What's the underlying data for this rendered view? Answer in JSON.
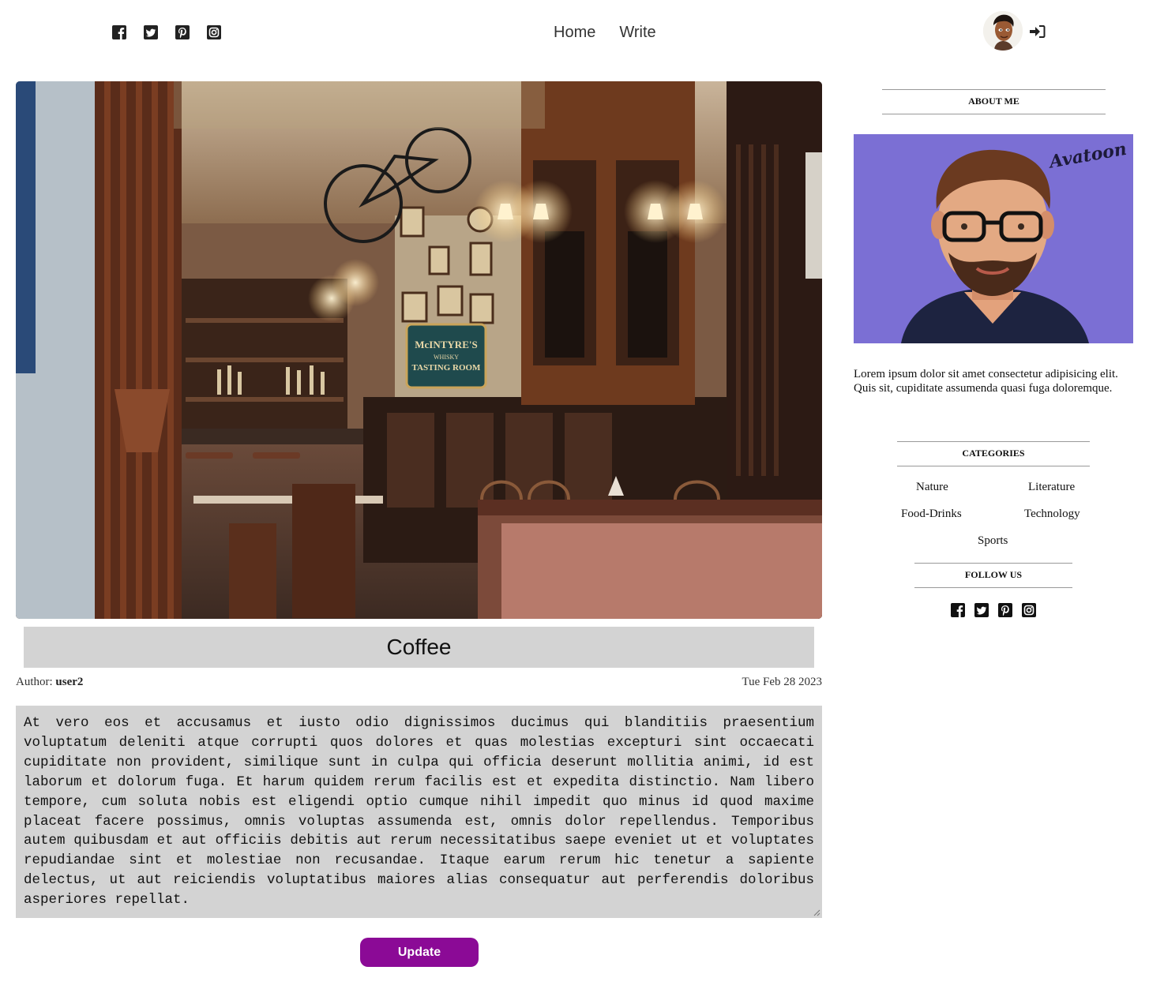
{
  "header": {
    "social_icons": [
      "facebook-icon",
      "twitter-icon",
      "pinterest-icon",
      "instagram-icon"
    ],
    "nav": [
      {
        "label": "Home"
      },
      {
        "label": "Write"
      }
    ],
    "user_icon": "avatar",
    "login_icon": "sign-in-icon"
  },
  "post": {
    "title": "Coffee",
    "author_prefix": "Author:",
    "author": "user2",
    "date": "Tue Feb 28 2023",
    "body": "At vero eos et accusamus et iusto odio dignissimos ducimus qui blanditiis praesentium voluptatum deleniti atque corrupti quos dolores et quas molestias excepturi sint occaecati cupiditate non provident, similique sunt in culpa qui officia deserunt mollitia animi, id est laborum et dolorum fuga. Et harum quidem rerum facilis est et expedita distinctio. Nam libero tempore, cum soluta nobis est eligendi optio cumque nihil impedit quo minus id quod maxime placeat facere possimus, omnis voluptas assumenda est, omnis dolor repellendus. Temporibus autem quibusdam et aut officiis debitis aut rerum necessitatibus saepe eveniet ut et voluptates repudiandae sint et molestiae non recusandae. Itaque earum rerum hic tenetur a sapiente delectus, ut aut reiciendis voluptatibus maiores alias consequatur aut perferendis doloribus asperiores repellat.",
    "update_label": "Update",
    "button_color": "#8b0a96",
    "sign_lines": [
      "McINTYRE'S",
      "WHISKY",
      "TASTING ROOM"
    ]
  },
  "sidebar": {
    "about_title": "ABOUT ME",
    "avatar_brand": "Avatoon",
    "about_text": "Lorem ipsum dolor sit amet consectetur adipisicing elit. Quis sit, cupiditate assumenda quasi fuga doloremque.",
    "categories_title": "CATEGORIES",
    "categories": [
      "Nature",
      "Literature",
      "Food-Drinks",
      "Technology",
      "Sports"
    ],
    "follow_title": "FOLLOW US",
    "follow_icons": [
      "facebook-icon",
      "twitter-icon",
      "pinterest-icon",
      "instagram-icon"
    ],
    "avatar_bg": "#7b6fd4"
  }
}
